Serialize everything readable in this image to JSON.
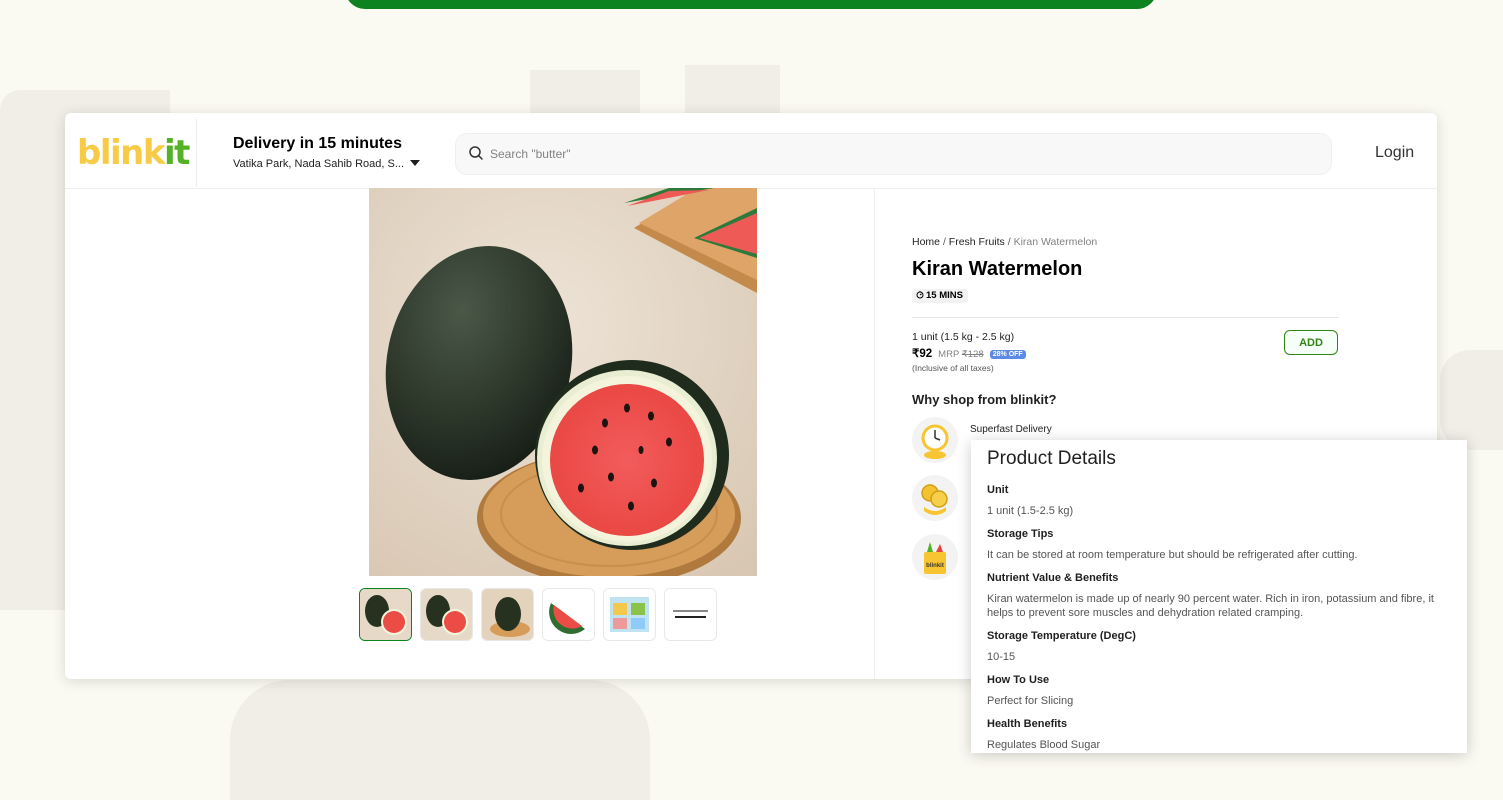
{
  "header": {
    "logo_part1": "blink",
    "logo_part2": "it",
    "delivery_title": "Delivery in 15 minutes",
    "delivery_address": "Vatika Park, Nada Sahib Road, S...",
    "search_placeholder": "Search \"butter\"",
    "login_label": "Login"
  },
  "breadcrumb": [
    {
      "label": "Home"
    },
    {
      "label": "Fresh Fruits"
    },
    {
      "label": "Kiran Watermelon"
    }
  ],
  "breadcrumb_separator": "/",
  "product": {
    "name": "Kiran Watermelon",
    "eta": "15 MINS",
    "unit": "1 unit (1.5 kg - 2.5 kg)",
    "price": "₹92",
    "mrp_label": "MRP",
    "mrp": "₹128",
    "discount": "28% OFF",
    "tax_note": "(Inclusive of all taxes)",
    "add_label": "ADD"
  },
  "why_shop": {
    "title": "Why shop from blinkit?",
    "items": [
      {
        "label": "Superfast Delivery",
        "icon": "delivery-clock-icon"
      },
      {
        "label": "",
        "icon": "coins-offer-icon"
      },
      {
        "label": "",
        "icon": "grocery-bag-icon",
        "icon_text": "blinkit"
      }
    ]
  },
  "thumbnails": [
    {
      "icon": "watermelon-thumb"
    },
    {
      "icon": "watermelon-thumb"
    },
    {
      "icon": "watermelon-thumb"
    },
    {
      "icon": "watermelon-slice-thumb"
    },
    {
      "icon": "info-graphic-thumb"
    },
    {
      "icon": "text-card-thumb"
    }
  ],
  "details": {
    "title": "Product Details",
    "items": [
      {
        "label": "Unit",
        "value": "1 unit (1.5-2.5 kg)"
      },
      {
        "label": "Storage Tips",
        "value": "It can be stored at room temperature but should be refrigerated after cutting."
      },
      {
        "label": "Nutrient Value & Benefits",
        "value": "Kiran watermelon is made up of nearly 90 percent water. Rich in iron, potassium and fibre, it helps to prevent sore muscles and dehydration related cramping."
      },
      {
        "label": "Storage Temperature (DegC)",
        "value": "10-15"
      },
      {
        "label": "How To Use",
        "value": "Perfect for Slicing"
      },
      {
        "label": "Health Benefits",
        "value": "Regulates Blood Sugar"
      }
    ]
  },
  "colors": {
    "brand_green": "#0c831f",
    "logo_yellow": "#f8cb46",
    "logo_green": "#54b226",
    "discount_blue": "#5c8ae6"
  }
}
